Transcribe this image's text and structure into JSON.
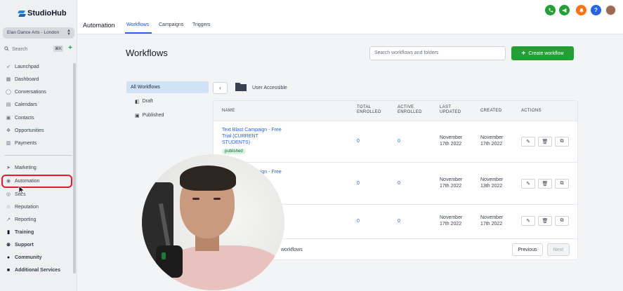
{
  "app": {
    "logo_text": "StudioHub"
  },
  "sidebar": {
    "account": "Elan Dance Arts - London",
    "search_label": "Search",
    "search_shortcut": "⌘K",
    "items": [
      {
        "label": "Launchpad",
        "icon": "rocket-icon"
      },
      {
        "label": "Dashboard",
        "icon": "dashboard-icon"
      },
      {
        "label": "Conversations",
        "icon": "chat-icon"
      },
      {
        "label": "Calendars",
        "icon": "calendar-icon"
      },
      {
        "label": "Contacts",
        "icon": "contacts-icon"
      },
      {
        "label": "Opportunities",
        "icon": "opportunities-icon"
      },
      {
        "label": "Payments",
        "icon": "payments-icon"
      },
      {
        "label": "Marketing",
        "icon": "send-icon"
      },
      {
        "label": "Automation",
        "icon": "automation-icon"
      },
      {
        "label": "Sites",
        "icon": "sites-icon"
      },
      {
        "label": "Reputation",
        "icon": "star-icon"
      },
      {
        "label": "Reporting",
        "icon": "reporting-icon"
      },
      {
        "label": "Training",
        "icon": "book-icon"
      },
      {
        "label": "Support",
        "icon": "support-icon"
      },
      {
        "label": "Community",
        "icon": "community-icon"
      },
      {
        "label": "Additional Services",
        "icon": "services-icon"
      }
    ]
  },
  "header": {
    "title": "Automation",
    "tabs": [
      "Workflows",
      "Campaigns",
      "Triggers"
    ],
    "active_tab": "Workflows",
    "avatar_colors": [
      "#22a036",
      "#22a036",
      "#f97316",
      "#2563eb"
    ]
  },
  "main": {
    "title": "Workflows",
    "search_placeholder": "Search workflows and folders",
    "create_label": "Create workflow",
    "filters": [
      "All Workflows",
      "Draft",
      "Published"
    ],
    "breadcrumb": "User Accessible",
    "table": {
      "headers": {
        "name": "NAME",
        "total": "TOTAL ENROLLED",
        "active": "ACTIVE ENROLLED",
        "updated": "LAST UPDATED",
        "created": "CREATED",
        "actions": "ACTIONS"
      },
      "rows": [
        {
          "name": "Text Blast Campaign - Free Trial (CURRENT STUDENTS)",
          "status": "published",
          "total": "0",
          "active": "0",
          "updated": "November 17th 2022",
          "created": "November 17th 2022"
        },
        {
          "name": "Text Blast Campaign - Free Trial (Students &",
          "status": "",
          "total": "0",
          "active": "0",
          "updated": "November 17th 2022",
          "created": "November 13th 2022"
        },
        {
          "name": "",
          "status": "",
          "total": "0",
          "active": "0",
          "updated": "November 17th 2022",
          "created": "November 17th 2022"
        }
      ],
      "footer_text": "workflows",
      "previous_label": "Previous",
      "next_label": "Next"
    }
  }
}
